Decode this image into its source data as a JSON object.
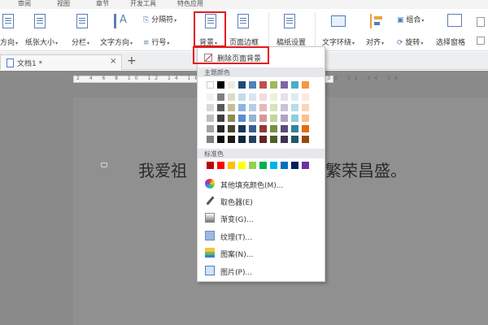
{
  "menu_tabs": [
    "审阅",
    "视图",
    "章节",
    "开发工具",
    "特色应用"
  ],
  "ribbon": {
    "orientation": "方向",
    "paper_size": "纸张大小",
    "columns": "分栏",
    "text_direction": "文字方向",
    "break": "分隔符",
    "line_number": "行号",
    "background": "背景",
    "page_border": "页面边框",
    "manuscript": "稿纸设置",
    "text_wrap": "文字环绕",
    "align": "对齐",
    "group": "组合",
    "rotate": "旋转",
    "select_pane": "选择窗格"
  },
  "document_tab": {
    "title": "文档1 *",
    "close": "×",
    "add": "+"
  },
  "ruler_numbers": "2 4 6 8 10 12 14 16 18 20 22 24 26 28 30 32 34 36",
  "document_text": {
    "left": "我爱祖",
    "right": "繁荣昌盛。"
  },
  "dropdown": {
    "delete_background": "删除页面背景",
    "theme_colors_label": "主题颜色",
    "standard_colors_label": "标准色",
    "theme_top": [
      "#ffffff",
      "#000000",
      "#eeece1",
      "#1f497d",
      "#4f81bd",
      "#c0504d",
      "#9bbb59",
      "#8064a2",
      "#4bacc6",
      "#f79646"
    ],
    "theme_shades": [
      [
        "#f2f2f2",
        "#7f7f7f",
        "#ddd9c3",
        "#c6d9f0",
        "#dbe5f1",
        "#f2dcdb",
        "#ebf1dd",
        "#e5e0ec",
        "#dbeef3",
        "#fdeada"
      ],
      [
        "#d8d8d8",
        "#595959",
        "#c4bd97",
        "#8db3e2",
        "#b8cce4",
        "#e5b9b7",
        "#d7e3bc",
        "#ccc1d9",
        "#b7dde8",
        "#fbd5b5"
      ],
      [
        "#bfbfbf",
        "#3f3f3f",
        "#938953",
        "#548dd4",
        "#95b3d7",
        "#d99694",
        "#c3d69b",
        "#b2a2c7",
        "#92cddc",
        "#fac08f"
      ],
      [
        "#a5a5a5",
        "#262626",
        "#494429",
        "#17365d",
        "#366092",
        "#953734",
        "#76923c",
        "#5f497a",
        "#31859b",
        "#e36c09"
      ],
      [
        "#7f7f7f",
        "#0c0c0c",
        "#1d1b10",
        "#0f243e",
        "#244061",
        "#632423",
        "#4f6128",
        "#3f3151",
        "#205867",
        "#974806"
      ]
    ],
    "standard_colors": [
      "#c00000",
      "#ff0000",
      "#ffc000",
      "#ffff00",
      "#92d050",
      "#00b050",
      "#00b0f0",
      "#0070c0",
      "#002060",
      "#7030a0"
    ],
    "items": [
      {
        "label": "其他填充颜色(M)..."
      },
      {
        "label": "取色器(E)"
      },
      {
        "label": "渐变(G)..."
      },
      {
        "label": "纹理(T)..."
      },
      {
        "label": "图案(N)..."
      },
      {
        "label": "图片(P)..."
      }
    ]
  }
}
